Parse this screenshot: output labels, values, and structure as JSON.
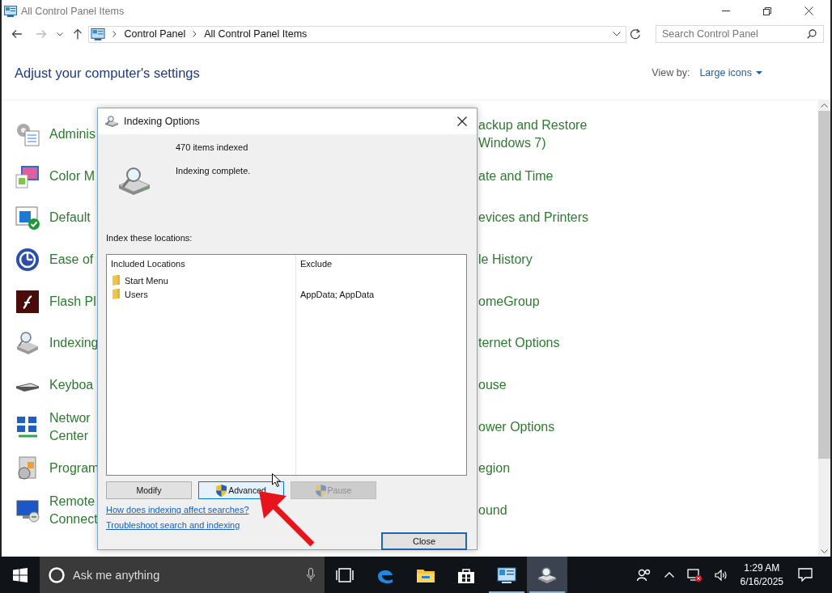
{
  "window": {
    "title": "All Control Panel Items"
  },
  "address_bar": {
    "path": [
      "Control Panel",
      "All Control Panel Items"
    ]
  },
  "search": {
    "placeholder": "Search Control Panel"
  },
  "heading": "Adjust your computer's settings",
  "view_by": {
    "label": "View by:",
    "value": "Large icons"
  },
  "items_left": [
    {
      "lines": [
        "Adminis"
      ]
    },
    {
      "lines": [
        "Color M"
      ]
    },
    {
      "lines": [
        "Default"
      ]
    },
    {
      "lines": [
        "Ease of"
      ]
    },
    {
      "lines": [
        "Flash Pl"
      ]
    },
    {
      "lines": [
        "Indexing"
      ]
    },
    {
      "lines": [
        "Keyboa"
      ]
    },
    {
      "lines": [
        "Networ",
        "Center"
      ]
    },
    {
      "lines": [
        "Program"
      ]
    },
    {
      "lines": [
        "Remote",
        "Connect"
      ]
    }
  ],
  "items_right": [
    {
      "lines": [
        "ackup and Restore",
        "Windows 7)"
      ]
    },
    {
      "lines": [
        "ate and Time"
      ]
    },
    {
      "lines": [
        "evices and Printers"
      ]
    },
    {
      "lines": [
        "le History"
      ]
    },
    {
      "lines": [
        "omeGroup"
      ]
    },
    {
      "lines": [
        "ternet Options"
      ]
    },
    {
      "lines": [
        "ouse"
      ]
    },
    {
      "lines": [
        "ower Options"
      ]
    },
    {
      "lines": [
        "egion"
      ]
    },
    {
      "lines": [
        "ound"
      ]
    }
  ],
  "dialog": {
    "title": "Indexing Options",
    "status": [
      "470 items indexed",
      "Indexing complete."
    ],
    "locations_label": "Index these locations:",
    "columns": [
      "Included Locations",
      "Exclude"
    ],
    "rows": [
      {
        "location": "Start Menu"
      },
      {
        "location": "Users",
        "exclude": "AppData; AppData"
      }
    ],
    "buttons": [
      {
        "label": "Modify",
        "shield": false,
        "disabled": false,
        "hovered": false
      },
      {
        "label": "Advanced",
        "shield": true,
        "disabled": false,
        "hovered": true
      },
      {
        "label": "Pause",
        "shield": true,
        "disabled": true,
        "hovered": false
      }
    ],
    "links": [
      "How does indexing affect searches?",
      "Troubleshoot search and indexing"
    ],
    "close_button": "Close"
  },
  "taskbar": {
    "search_placeholder": "Ask me anything",
    "apps": [
      {
        "open": false,
        "selected": false
      },
      {
        "open": false,
        "selected": false
      },
      {
        "open": false,
        "selected": false
      },
      {
        "open": false,
        "selected": false
      },
      {
        "open": true,
        "selected": false
      },
      {
        "open": true,
        "selected": true
      }
    ],
    "time": "1:29 AM",
    "date": "6/16/2025"
  }
}
